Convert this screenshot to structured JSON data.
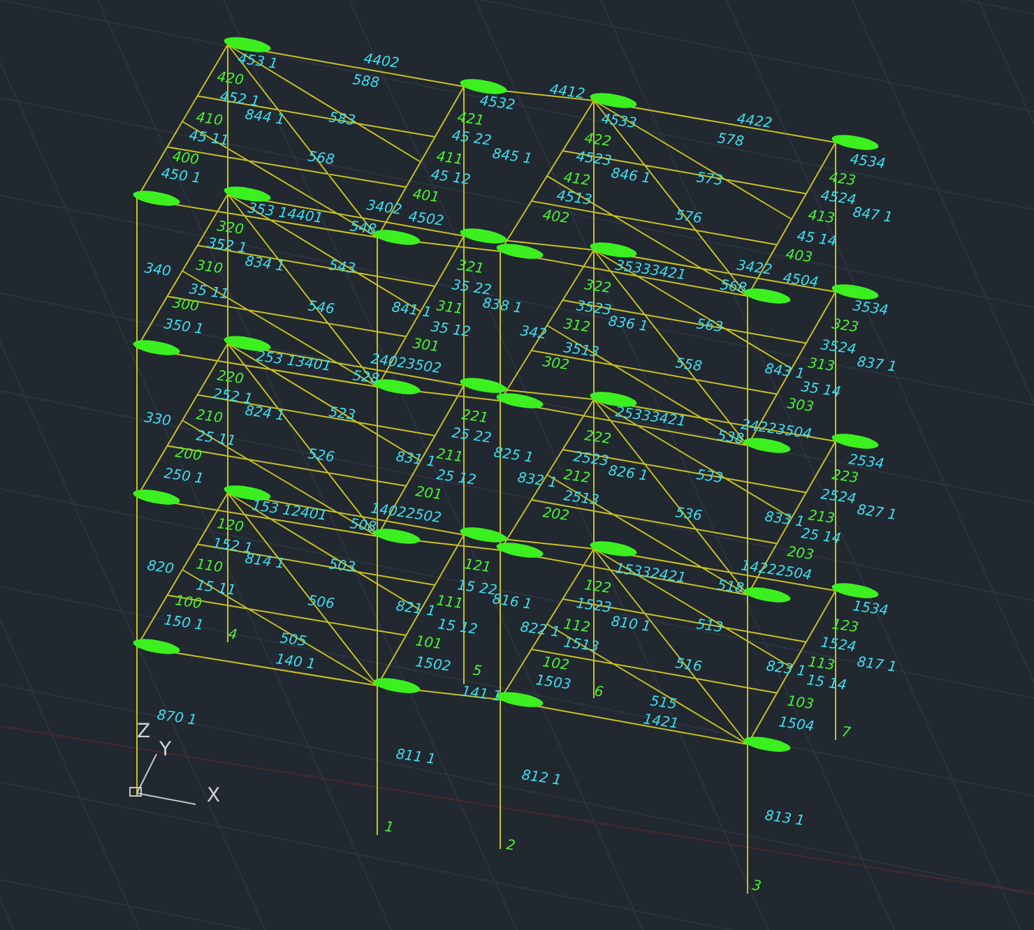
{
  "viewport": {
    "node_labels": [
      "420",
      "410",
      "400",
      "421",
      "411",
      "401",
      "320",
      "310",
      "300",
      "321",
      "311",
      "301",
      "422",
      "412",
      "402",
      "423",
      "413",
      "403",
      "322",
      "312",
      "302",
      "323",
      "313",
      "303",
      "220",
      "210",
      "200",
      "221",
      "211",
      "201",
      "120",
      "110",
      "100",
      "121",
      "111",
      "101",
      "222",
      "212",
      "202",
      "223",
      "213",
      "203",
      "122",
      "112",
      "102",
      "123",
      "113",
      "103",
      "1",
      "2",
      "3",
      "4",
      "5",
      "6",
      "7"
    ],
    "member_labels": [
      "4402",
      "453 1",
      "588",
      "452 1",
      "844 1",
      "583",
      "45 11",
      "568",
      "450 1",
      "45 22",
      "45 12",
      "4532",
      "4412",
      "845 1",
      "4533",
      "4422",
      "578",
      "4523",
      "846 1",
      "573",
      "4534",
      "4513",
      "576",
      "4524",
      "847 1",
      "45 14",
      "353 14401",
      "3402",
      "4502",
      "548",
      "352 1",
      "340",
      "834 1",
      "543",
      "35 11",
      "546",
      "841 1",
      "350 1",
      "35 22",
      "35 12",
      "35333421",
      "3422",
      "4504",
      "568",
      "3534",
      "3523",
      "836 1",
      "838 1",
      "342",
      "563",
      "3513",
      "3524",
      "558",
      "843 1",
      "837 1",
      "35 14",
      "253 13401",
      "24023502",
      "528",
      "252 1",
      "330",
      "824 1",
      "523",
      "25 11",
      "25 22",
      "825 1",
      "526",
      "831 1",
      "25 12",
      "250 1",
      "25333421",
      "24223504",
      "538",
      "2534",
      "2523",
      "826 1",
      "832 1",
      "533",
      "2513",
      "2524",
      "536",
      "833 1",
      "827 1",
      "25 14",
      "153 12401",
      "14022502",
      "508",
      "152 1",
      "820",
      "814 1",
      "503",
      "15 11",
      "15 22",
      "816 1",
      "506",
      "821 1",
      "15 12",
      "150 1",
      "505",
      "140 1",
      "1502",
      "15332421",
      "14222504",
      "518",
      "1534",
      "1523",
      "810 1",
      "822 1",
      "513",
      "1513",
      "1524",
      "516",
      "823 1",
      "817 1",
      "15 14",
      "1503",
      "515",
      "1421",
      "1504",
      "141 1",
      "870 1",
      "811 1",
      "812 1",
      "813 1"
    ],
    "axis_labels": [
      "X",
      "Y",
      "Z"
    ]
  }
}
